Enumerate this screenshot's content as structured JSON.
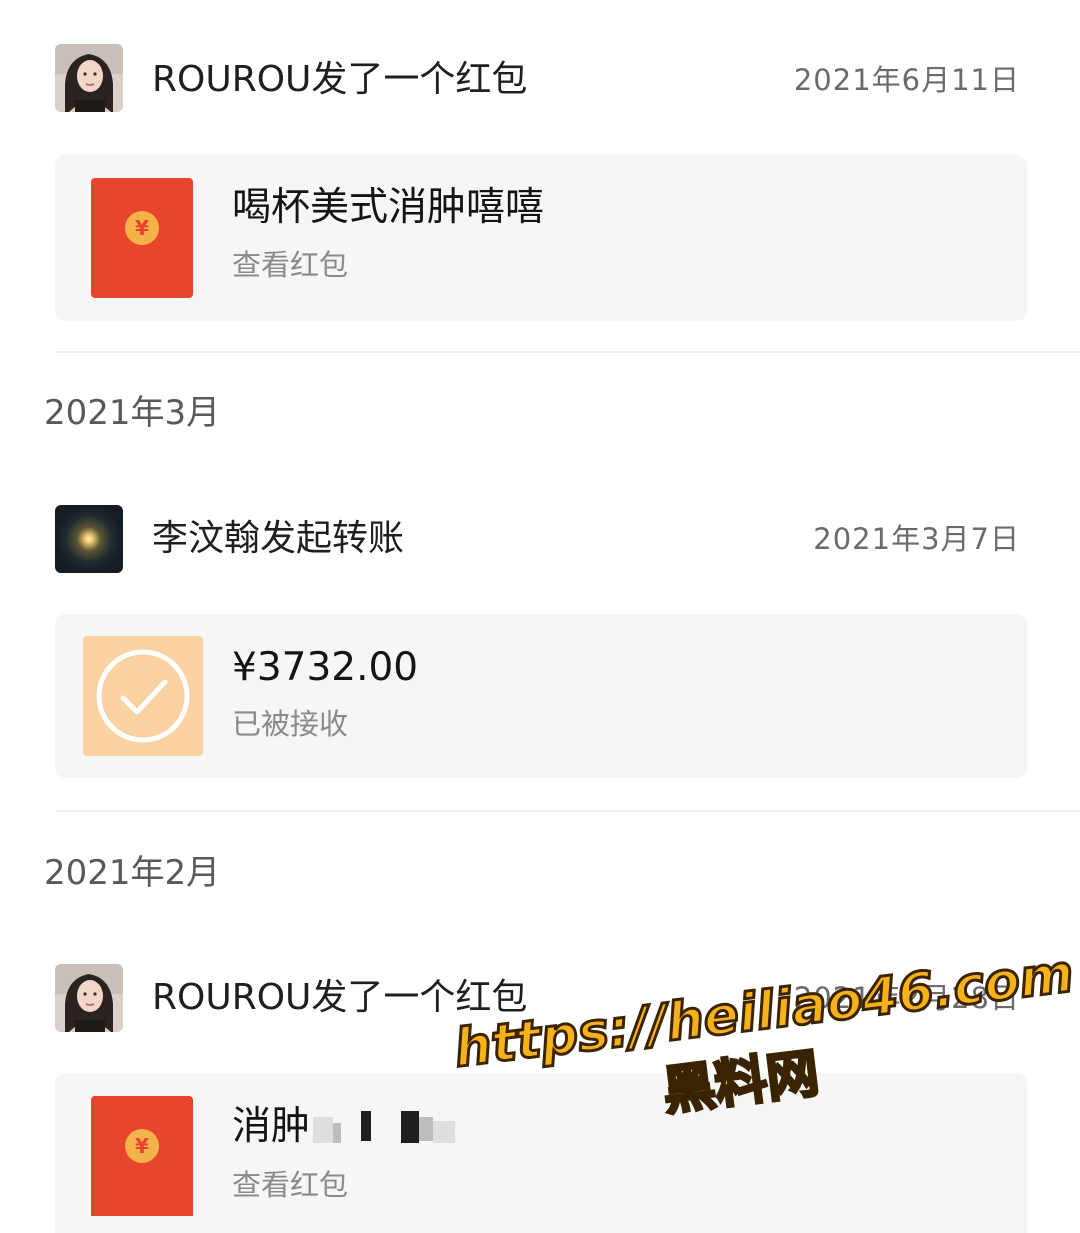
{
  "feed": {
    "entries": [
      {
        "sender": "ROUROU发了一个红包",
        "date": "2021年6月11日",
        "avatar_icon": "person-photo-icon",
        "card": {
          "type": "red-packet",
          "icon": "red-envelope-icon",
          "title": "喝杯美式消肿嘻嘻",
          "subtitle": "查看红包"
        }
      },
      {
        "sender": "李汶翰发起转账",
        "date": "2021年3月7日",
        "avatar_icon": "dark-light-orb-icon",
        "card": {
          "type": "transfer",
          "icon": "transfer-received-check-icon",
          "title": "¥3732.00",
          "subtitle": "已被接收"
        }
      },
      {
        "sender": "ROUROU发了一个红包",
        "date": "2021年2月28日",
        "avatar_icon": "person-photo-icon",
        "card": {
          "type": "red-packet",
          "icon": "red-envelope-icon",
          "title": "消肿",
          "subtitle": "查看红包"
        }
      }
    ],
    "months": [
      "2021年3月",
      "2021年2月"
    ]
  },
  "watermark": {
    "url": "https://heiliao46.com",
    "site": "黑料网"
  },
  "colors": {
    "card_bg": "#f6f6f6",
    "red_packet": "#e8452c",
    "coin": "#f3b24a",
    "transfer_bg": "#fbd2a1",
    "watermark": "#f7b21a"
  }
}
